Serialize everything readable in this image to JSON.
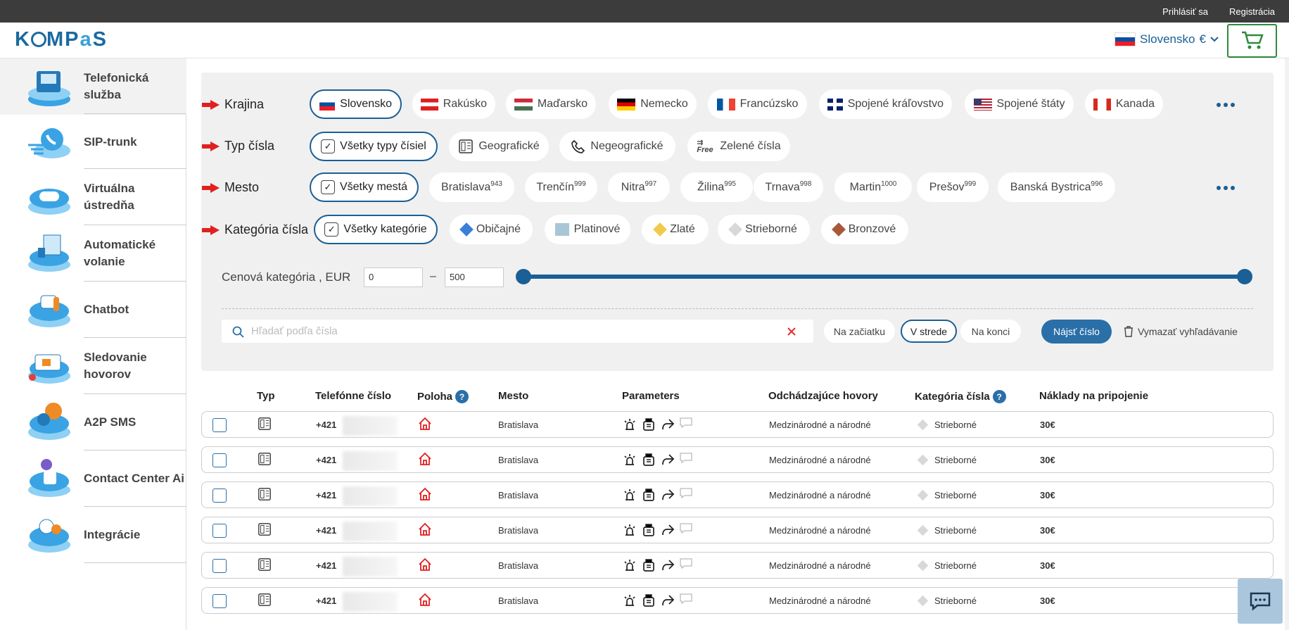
{
  "topbar": {
    "login": "Prihlásiť sa",
    "register": "Registrácia"
  },
  "header": {
    "logo": "KOMPaS",
    "country": "Slovensko",
    "currency": "€"
  },
  "sidebar": {
    "items": [
      {
        "label": "Telefonická služba",
        "icon": "phone-service-icon"
      },
      {
        "label": "SIP-trunk",
        "icon": "sip-trunk-icon"
      },
      {
        "label": "Virtuálna ústredňa",
        "icon": "virtual-pbx-icon"
      },
      {
        "label": "Automatické volanie",
        "icon": "auto-dialer-icon"
      },
      {
        "label": "Chatbot",
        "icon": "chatbot-icon"
      },
      {
        "label": "Sledovanie hovorov",
        "icon": "call-tracking-icon"
      },
      {
        "label": "A2P SMS",
        "icon": "sms-icon"
      },
      {
        "label": "Contact Center Ai",
        "icon": "contact-center-icon"
      },
      {
        "label": "Integrácie",
        "icon": "integrations-icon"
      }
    ]
  },
  "filters": {
    "country_label": "Krajina",
    "countries": [
      "Slovensko",
      "Rakúsko",
      "Maďarsko",
      "Nemecko",
      "Francúzsko",
      "Spojené kráľovstvo",
      "Spojené štáty",
      "Kanada"
    ],
    "type_label": "Typ čísla",
    "types": [
      "Všetky typy čísiel",
      "Geografické",
      "Negeografické",
      "Zelené čísla"
    ],
    "free_badge": "Free",
    "city_label": "Mesto",
    "all_cities": "Všetky mestá",
    "cities": [
      {
        "name": "Bratislava",
        "count": "943"
      },
      {
        "name": "Trenčín",
        "count": "999"
      },
      {
        "name": "Nitra",
        "count": "997"
      },
      {
        "name": "Žilina",
        "count": "995"
      },
      {
        "name": "Trnava",
        "count": "998"
      },
      {
        "name": "Martin",
        "count": "1000"
      },
      {
        "name": "Prešov",
        "count": "999"
      },
      {
        "name": "Banská Bystrica",
        "count": "996"
      }
    ],
    "category_label": "Kategória čísla",
    "categories": [
      "Všetky kategórie",
      "Običajné",
      "Platinové",
      "Zlaté",
      "Strieborné",
      "Bronzové"
    ],
    "category_colors": [
      "",
      "#3b7fd9",
      "#a8c6d6",
      "#f2c94c",
      "#d8d8d8",
      "#a8583a"
    ],
    "price_label": "Cenová kategória , EUR",
    "price_min": "0",
    "price_max": "500",
    "price_range_min": 0,
    "price_range_max": 500,
    "search_placeholder": "Hľadať podľa čísla",
    "position_options": [
      "Na začiatku",
      "V strede",
      "Na konci"
    ],
    "find_button": "Nájsť číslo",
    "clear_button": "Vymazať vyhľadávanie"
  },
  "table": {
    "headers": [
      "Typ",
      "Telefónne číslo",
      "Poloha",
      "Mesto",
      "Parameters",
      "Odchádzajúce hovory",
      "Kategória čísla",
      "Náklady na pripojenie"
    ],
    "rows": [
      {
        "prefix": "+421",
        "city": "Bratislava",
        "calls": "Medzinárodné a národné",
        "category": "Strieborné",
        "cost": "30€"
      },
      {
        "prefix": "+421",
        "city": "Bratislava",
        "calls": "Medzinárodné a národné",
        "category": "Strieborné",
        "cost": "30€"
      },
      {
        "prefix": "+421",
        "city": "Bratislava",
        "calls": "Medzinárodné a národné",
        "category": "Strieborné",
        "cost": "30€"
      },
      {
        "prefix": "+421",
        "city": "Bratislava",
        "calls": "Medzinárodné a národné",
        "category": "Strieborné",
        "cost": "30€"
      },
      {
        "prefix": "+421",
        "city": "Bratislava",
        "calls": "Medzinárodné a národné",
        "category": "Strieborné",
        "cost": "30€"
      },
      {
        "prefix": "+421",
        "city": "Bratislava",
        "calls": "Medzinárodné a národné",
        "category": "Strieborné",
        "cost": "30€"
      }
    ]
  },
  "colors": {
    "accent": "#1a5f95",
    "button": "#2a6fa8",
    "arrow": "#e02020",
    "cart": "#2e8b3e"
  }
}
